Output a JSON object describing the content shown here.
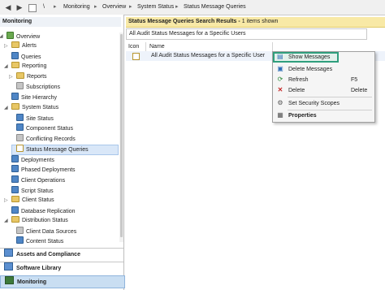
{
  "breadcrumb": {
    "back_icon": "back-arrow-icon",
    "forward_icon": "forward-arrow-icon",
    "root": "\\",
    "items": [
      "Monitoring",
      "Overview",
      "System Status",
      "Status Message Queries"
    ],
    "separator": "▸"
  },
  "nav": {
    "header": "Monitoring",
    "tree": [
      {
        "label": "Overview",
        "icon": "overview-icon"
      },
      {
        "label": "Alerts",
        "icon": "folder-icon"
      },
      {
        "label": "Queries",
        "icon": "queries-icon"
      },
      {
        "label": "Reporting",
        "icon": "folder-icon"
      },
      {
        "label": "Reports",
        "icon": "folder-icon"
      },
      {
        "label": "Subscriptions",
        "icon": "subscriptions-icon"
      },
      {
        "label": "Site Hierarchy",
        "icon": "site-hierarchy-icon"
      },
      {
        "label": "System Status",
        "icon": "folder-icon"
      },
      {
        "label": "Site Status",
        "icon": "site-status-icon"
      },
      {
        "label": "Component Status",
        "icon": "component-status-icon"
      },
      {
        "label": "Conflicting Records",
        "icon": "conflicting-records-icon"
      },
      {
        "label": "Status Message Queries",
        "icon": "status-message-queries-icon"
      },
      {
        "label": "Deployments",
        "icon": "deployments-icon"
      },
      {
        "label": "Phased Deployments",
        "icon": "phased-deployments-icon"
      },
      {
        "label": "Client Operations",
        "icon": "client-operations-icon"
      },
      {
        "label": "Script Status",
        "icon": "script-status-icon"
      },
      {
        "label": "Client Status",
        "icon": "folder-icon"
      },
      {
        "label": "Database Replication",
        "icon": "database-replication-icon"
      },
      {
        "label": "Distribution Status",
        "icon": "folder-icon"
      },
      {
        "label": "Client Data Sources",
        "icon": "client-data-sources-icon"
      },
      {
        "label": "Content Status",
        "icon": "content-status-icon"
      }
    ],
    "workspaces": [
      {
        "label": "Assets and Compliance",
        "icon": "assets-compliance-icon"
      },
      {
        "label": "Software Library",
        "icon": "software-library-icon"
      },
      {
        "label": "Monitoring",
        "icon": "monitoring-icon"
      }
    ]
  },
  "results": {
    "title": "Status Message Queries Search Results",
    "count_text": "1 items shown",
    "filter_text": "All Audit Status Messages for a Specific Users",
    "columns": [
      "Icon",
      "Name"
    ],
    "rows": [
      {
        "icon": "status-message-query-icon",
        "name": "All Audit Status Messages for a Specific User"
      }
    ]
  },
  "context_menu": {
    "items": [
      {
        "label": "Show Messages",
        "icon": "show-messages-icon",
        "key": ""
      },
      {
        "label": "Delete Messages",
        "icon": "delete-messages-icon",
        "key": ""
      },
      {
        "label": "Refresh",
        "icon": "refresh-icon",
        "key": "F5"
      },
      {
        "label": "Delete",
        "icon": "delete-icon",
        "key": "Delete"
      },
      {
        "label": "Set Security Scopes",
        "icon": "security-scopes-icon",
        "key": ""
      },
      {
        "label": "Properties",
        "icon": "properties-icon",
        "key": ""
      }
    ],
    "highlight_color": "#2f9e7d"
  },
  "colors": {
    "results_header_bg": "#f8e9a6",
    "selection_bg": "#d9e7f8",
    "accent": "#2f9e7d"
  }
}
